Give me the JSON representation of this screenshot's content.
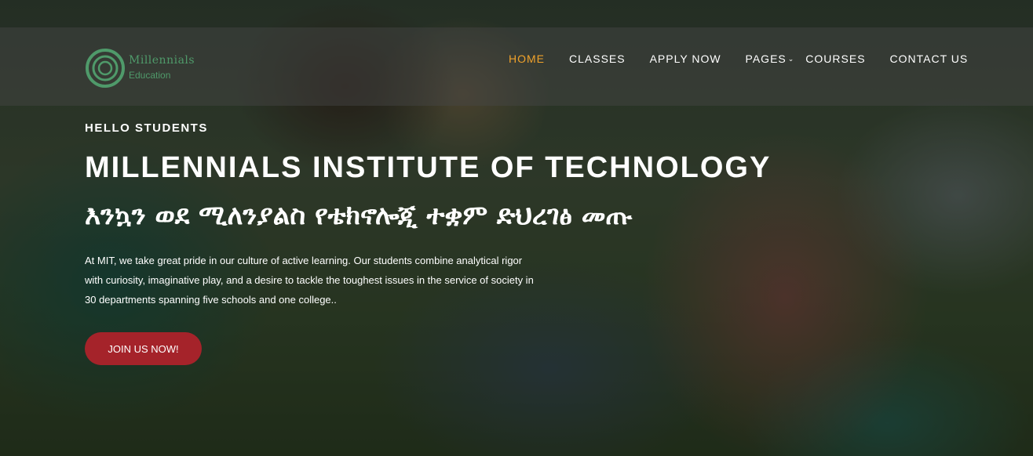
{
  "brand": {
    "name": "Millennials",
    "subtitle": "Education",
    "logo_icon": "concentric-circles-logo",
    "color": "#4f9a6a"
  },
  "nav": {
    "items": [
      {
        "label": "HOME",
        "active": true
      },
      {
        "label": "CLASSES",
        "active": false
      },
      {
        "label": "APPLY NOW",
        "active": false
      },
      {
        "label": "PAGES",
        "active": false,
        "dropdown_icon": "chevron-down-icon"
      },
      {
        "label": "COURSES",
        "active": false
      },
      {
        "label": "CONTACT US",
        "active": false
      }
    ],
    "active_color": "#f0a22b"
  },
  "hero": {
    "eyebrow": "HELLO STUDENTS",
    "title": "MILLENNIALS INSTITUTE OF TECHNOLOGY",
    "subtitle": "እንኳን ወደ ሚለንያልስ የቴክኖሎጂ ተቋም ድህረገፅ መጡ",
    "description": "At MIT, we take great pride in our culture of active learning. Our students combine analytical rigor with curiosity, imaginative play, and a desire to tackle the toughest issues in the service of society in 30 departments spanning five schools and one college..",
    "cta_label": "JOIN US NOW!",
    "cta_color": "#a5232a"
  }
}
